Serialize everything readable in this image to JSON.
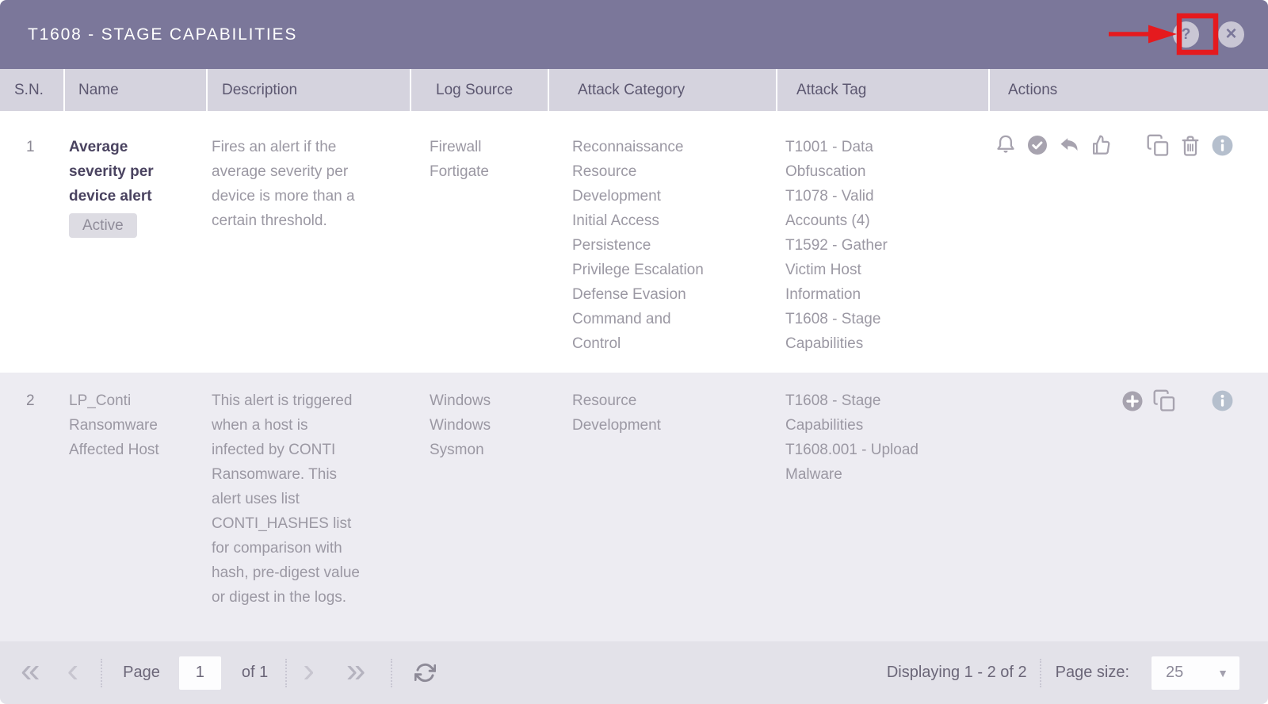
{
  "colors": {
    "header_purple": "#7b779a",
    "table_header_bg": "#d5d3de",
    "row_alt_bg": "#edecf2",
    "annotation_red": "#e51a1e",
    "info_icon_blue": "#b5bfcd"
  },
  "header": {
    "title": "T1608 - STAGE CAPABILITIES",
    "help_glyph": "?",
    "close_glyph": "×",
    "annotation": {
      "type": "red-arrow-and-box",
      "target": "help-icon"
    }
  },
  "table": {
    "columns": [
      "S.N.",
      "Name",
      "Description",
      "Log Source",
      "Attack Category",
      "Attack Tag",
      "Actions"
    ],
    "rows": [
      {
        "sn": "1",
        "name": "Average severity per device alert",
        "status_badge": "Active",
        "description": "Fires an alert if the average severity per device is more than a certain threshold.",
        "log_sources": [
          "Firewall Fortigate"
        ],
        "attack_categories": [
          "Reconnaissance",
          "Resource Development",
          "Initial Access",
          "Persistence",
          "Privilege Escalation",
          "Defense Evasion",
          "Command and Control"
        ],
        "attack_tags": [
          "T1001 - Data Obfuscation",
          "T1078 - Valid Accounts (4)",
          "T1592 - Gather Victim Host Information",
          "T1608 - Stage Capabilities"
        ],
        "action_groups": [
          [
            "bell-icon",
            "check-circle-icon",
            "reply-icon",
            "thumbs-up-icon"
          ],
          [
            "copy-icon",
            "trash-icon",
            "info-icon"
          ]
        ]
      },
      {
        "sn": "2",
        "name": "LP_Conti Ransomware Affected Host",
        "description": "This alert is triggered when a host is infected by CONTI Ransomware. This alert uses list CONTI_HASHES list for comparison with hash, pre-digest value or digest in the logs.",
        "log_sources": [
          "Windows",
          "Windows Sysmon"
        ],
        "attack_categories": [
          "Resource Development"
        ],
        "attack_tags": [
          "T1608 - Stage Capabilities",
          "T1608.001 - Upload Malware"
        ],
        "action_groups": [
          [
            "plus-circle-icon",
            "copy-icon"
          ],
          [
            "info-icon"
          ]
        ]
      }
    ]
  },
  "footer": {
    "first_glyph": "«",
    "prev_glyph": "‹",
    "page_label": "Page",
    "page_value": "1",
    "of_label": "of 1",
    "next_glyph": "›",
    "last_glyph": "»",
    "displaying_text": "Displaying 1 - 2 of 2",
    "page_size_label": "Page size:",
    "page_size_value": "25",
    "caret_glyph": "▼"
  }
}
